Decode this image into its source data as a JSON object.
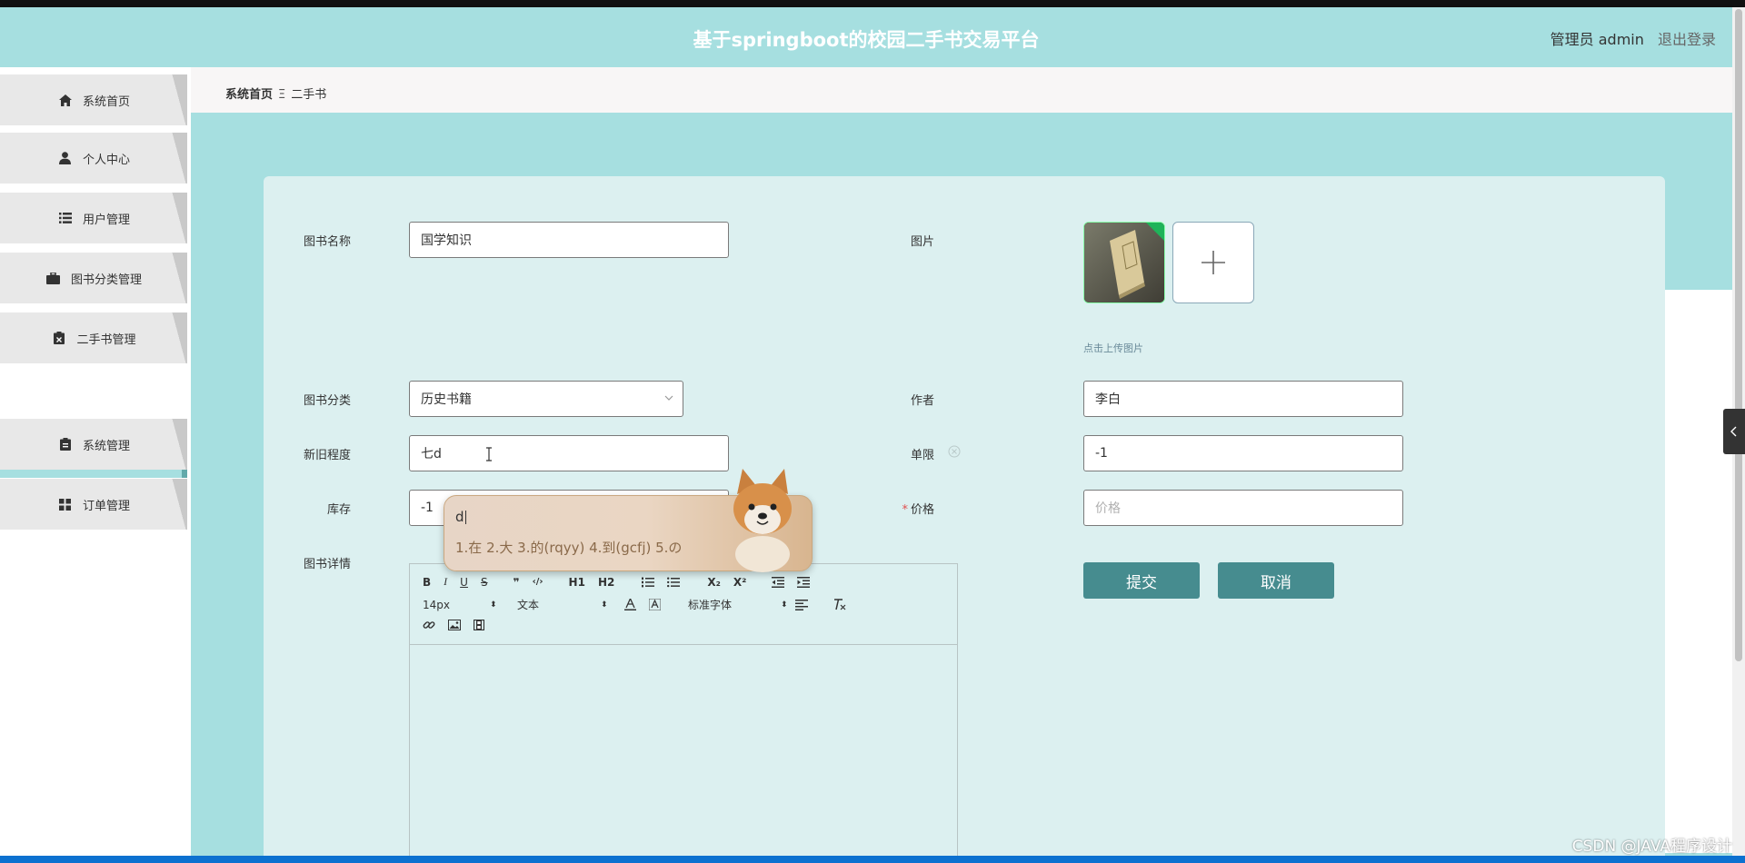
{
  "header": {
    "title": "基于springboot的校园二手书交易平台",
    "user_label": "管理员 admin",
    "logout_label": "退出登录"
  },
  "sidebar": {
    "items": [
      {
        "label": "系统首页",
        "icon": "home-icon"
      },
      {
        "label": "个人中心",
        "icon": "user-icon"
      },
      {
        "label": "用户管理",
        "icon": "list-icon"
      },
      {
        "label": "图书分类管理",
        "icon": "briefcase-icon"
      },
      {
        "label": "二手书管理",
        "icon": "clipboard-icon"
      },
      {
        "label": "系统管理",
        "icon": "clipboard-icon"
      },
      {
        "label": "订单管理",
        "icon": "grid-icon"
      }
    ],
    "active_sub": "二手书"
  },
  "breadcrumb": {
    "home": "系统首页",
    "separator": "Ξ",
    "current": "二手书"
  },
  "form": {
    "book_name": {
      "label": "图书名称",
      "value": "国学知识"
    },
    "category": {
      "label": "图书分类",
      "value": "历史书籍"
    },
    "condition": {
      "label": "新旧程度",
      "value": "七d"
    },
    "stock": {
      "label": "库存",
      "value": "-1"
    },
    "details": {
      "label": "图书详情"
    },
    "image": {
      "label": "图片",
      "hint": "点击上传图片"
    },
    "author": {
      "label": "作者",
      "value": "李白"
    },
    "limit": {
      "label": "单限",
      "value": "-1"
    },
    "price": {
      "label": "价格",
      "placeholder": "价格",
      "required_mark": "*"
    },
    "submit_label": "提交",
    "cancel_label": "取消"
  },
  "editor": {
    "row1": [
      "B",
      "I",
      "U",
      "S",
      "❞",
      "‹/›",
      "H1",
      "H2",
      "ordered-list",
      "bullet-list",
      "X₂",
      "X²",
      "outdent",
      "indent"
    ],
    "font_size": "14px",
    "text_type": "文本",
    "font_family": "标准字体"
  },
  "ime": {
    "composition": "d",
    "candidates": "1.在  2.大  3.的(rqyy)  4.到(gcfj)  5.の"
  },
  "watermark": "CSDN @JAVA程序设计",
  "colors": {
    "header_bg": "#a6dfe0",
    "card_bg": "#dcf0f0",
    "button_bg": "#468c8f",
    "sidebar_item_bg": "#e8e8e8"
  }
}
